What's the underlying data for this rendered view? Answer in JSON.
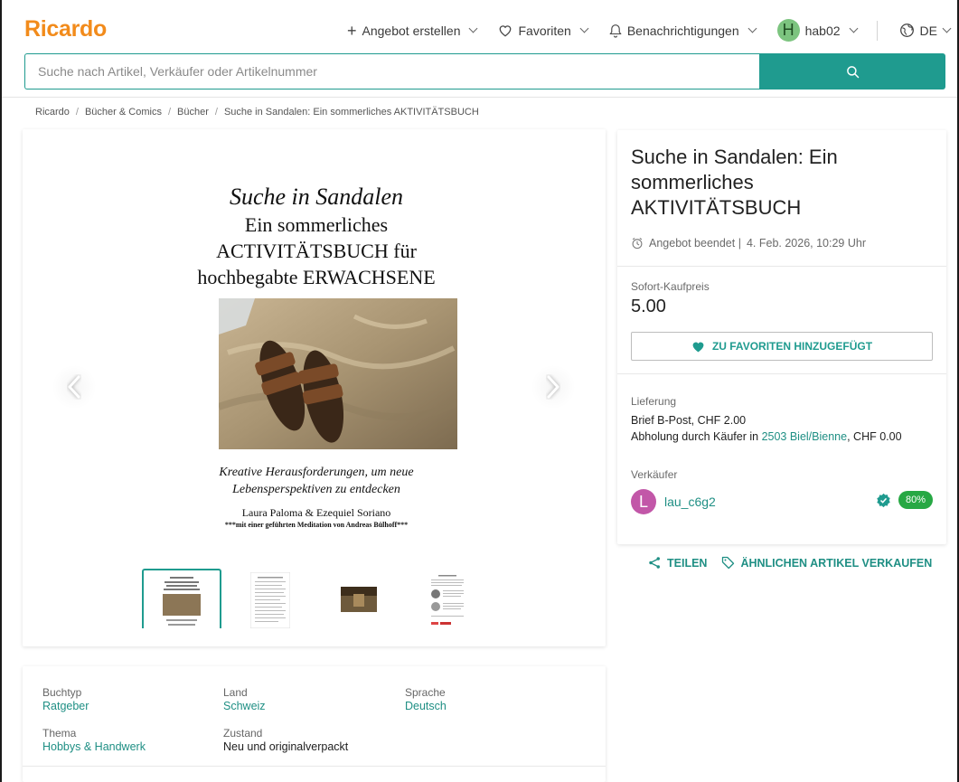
{
  "header": {
    "logo": "Ricardo",
    "create_label": "Angebot erstellen",
    "favorites_label": "Favoriten",
    "notifications_label": "Benachrichtigungen",
    "user_initial": "H",
    "username": "hab02",
    "language": "DE",
    "brand_color": "#f28b1b",
    "accent_color": "#1f9b8f"
  },
  "search": {
    "placeholder": "Suche nach Artikel, Verkäufer oder Artikelnummer",
    "value": ""
  },
  "breadcrumb": [
    "Ricardo",
    "Bücher & Comics",
    "Bücher",
    "Suche in Sandalen: Ein sommerliches AKTIVITÄTSBUCH"
  ],
  "cover": {
    "title_italic": "Suche in Sandalen",
    "title_line2": "Ein sommerliches",
    "title_line3": "ACTIVITÄTSBUCH für",
    "title_line4": "hochbegabte ERWACHSENE",
    "subtitle_line1": "Kreative Herausforderungen, um neue",
    "subtitle_line2": "Lebensperspektiven zu entdecken",
    "authors": "Laura Paloma & Ezequiel Soriano",
    "meditation": "***mit einer geführten Meditation von Andreas Bülhoff***"
  },
  "listing": {
    "title": "Suche in Sandalen: Ein sommerliches AKTIVITÄTSBUCH",
    "ended_status": "Angebot beendet |",
    "ended_date": "4. Feb. 2026, 10:29 Uhr",
    "price_label": "Sofort-Kaufpreis",
    "price": "5.00",
    "favorite_button": "ZU FAVORITEN HINZUGEFÜGT",
    "delivery_label": "Lieferung",
    "delivery_line1": "Brief B-Post, CHF 2.00",
    "pickup_prefix": "Abholung durch Käufer in",
    "pickup_location": "2503 Biel/Bienne",
    "pickup_suffix": ", CHF 0.00",
    "seller_label": "Verkäufer",
    "seller_initial": "L",
    "seller_name": "lau_c6g2",
    "seller_rating": "80%"
  },
  "actions": {
    "share": "TEILEN",
    "sell_similar": "ÄHNLICHEN ARTIKEL VERKAUFEN"
  },
  "details": {
    "buchtyp_label": "Buchtyp",
    "buchtyp_value": "Ratgeber",
    "land_label": "Land",
    "land_value": "Schweiz",
    "sprache_label": "Sprache",
    "sprache_value": "Deutsch",
    "thema_label": "Thema",
    "thema_value": "Hobbys & Handwerk",
    "zustand_label": "Zustand",
    "zustand_value": "Neu und originalverpackt"
  }
}
